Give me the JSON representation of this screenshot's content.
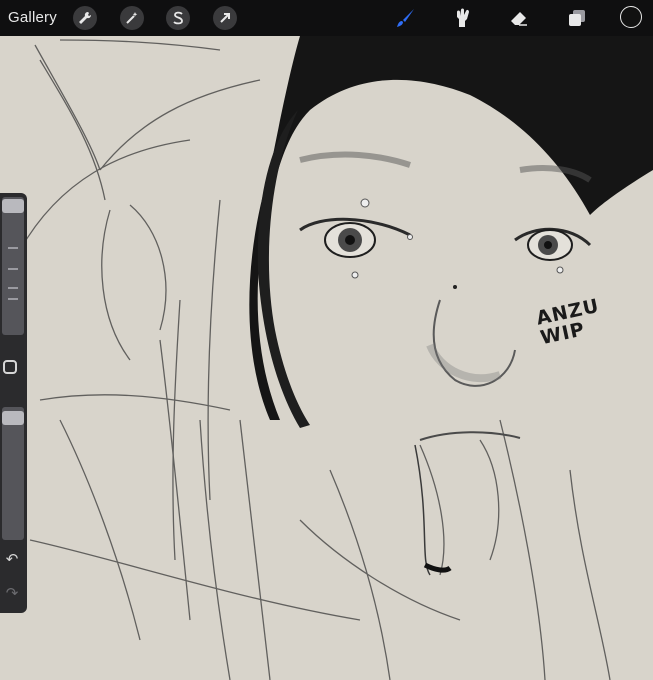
{
  "app": {
    "gallery_label": "Gallery"
  },
  "toolbar": {
    "left_tools": [
      "wrench-icon",
      "magic-wand-icon",
      "selection-s-icon",
      "transform-arrow-icon"
    ],
    "right_tools": [
      "brush-icon",
      "smudge-icon",
      "eraser-icon",
      "layers-icon"
    ],
    "active_tool": "brush-icon",
    "active_color": "#2f6df6",
    "current_color": "#111111"
  },
  "sidebar": {
    "size_slider_value": 0.02,
    "opacity_slider_value": 0.06,
    "undo_icon": "undo-icon",
    "redo_icon": "redo-icon"
  },
  "canvas": {
    "paper_color": "#d9d5cd",
    "annotation_line1": "ANZU",
    "annotation_line2": "WIP"
  }
}
